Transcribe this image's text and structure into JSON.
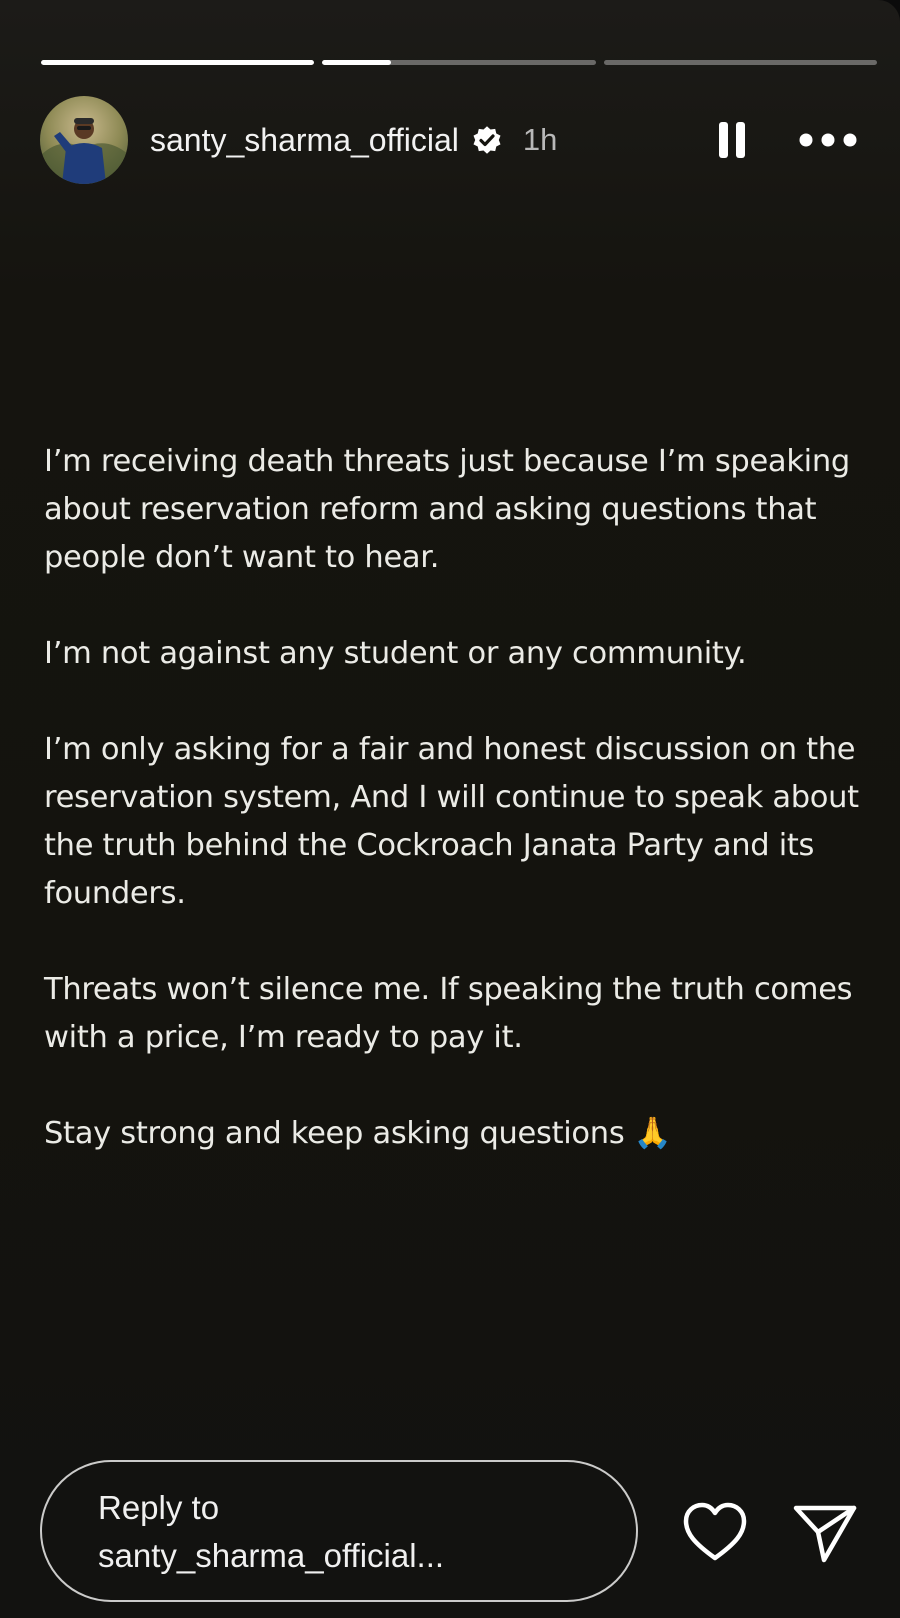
{
  "story": {
    "progress": [
      1.0,
      0.25,
      0.0
    ],
    "author": {
      "username": "santy_sharma_official",
      "verified": true,
      "time_ago": "1h"
    },
    "paragraphs": [
      "I’m receiving death threats just because I’m speaking about reservation reform and asking questions that people don’t want to hear.",
      "I’m not against any student or any community.",
      "I’m only asking for a fair and honest discussion on the reservation system, And I will continue to speak about the truth behind the Cockroach Janata Party and its founders.",
      "Threats won’t silence me. If speaking the truth comes with a price, I’m ready to pay it.",
      "Stay strong and keep asking questions 🙏"
    ],
    "icons": {
      "pause": "pause-icon",
      "more": "more-options-icon",
      "like": "heart-icon",
      "share": "send-icon",
      "verified": "verified-badge-icon"
    }
  },
  "footer": {
    "reply_line1": "Reply to",
    "reply_line2": "santy_sharma_official..."
  },
  "colors": {
    "background": "#14130e",
    "text": "#ebebe6",
    "progress_track": "#5a5a5a",
    "progress_fill": "#ffffff"
  }
}
